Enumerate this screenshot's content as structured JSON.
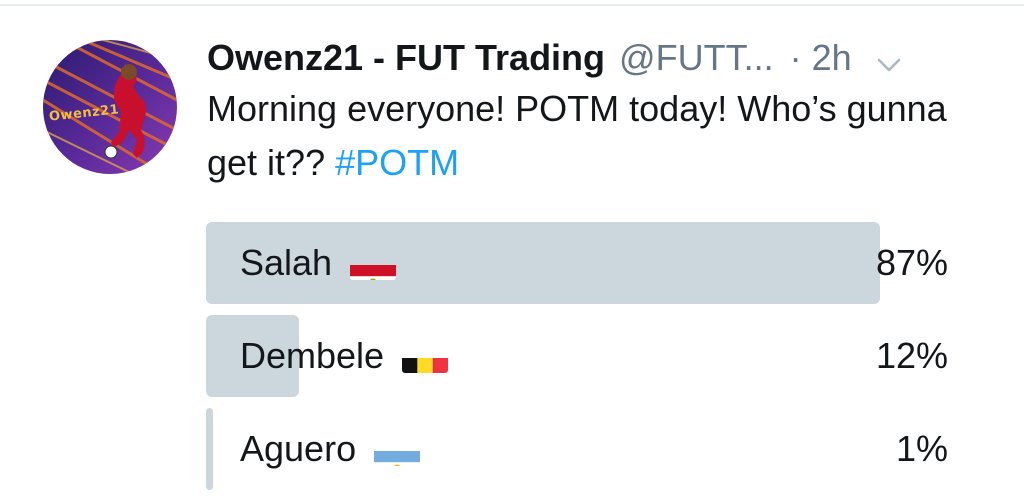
{
  "tweet": {
    "display_name": "Owenz21 - FUT Trading",
    "handle": "@FUTT...",
    "time": "· 2h",
    "text_main": "Morning everyone! POTM today! Who’s gunna get it?? ",
    "hashtag": "#POTM",
    "avatar_text": "Owenz21"
  },
  "poll": {
    "options": [
      {
        "label": "Salah",
        "flag_icon": "egypt-flag-icon",
        "percent_text": "87%",
        "percent": 87
      },
      {
        "label": "Dembele",
        "flag_icon": "belgium-flag-icon",
        "percent_text": "12%",
        "percent": 12
      },
      {
        "label": "Aguero",
        "flag_icon": "argentina-flag-icon",
        "percent_text": "1%",
        "percent": 1
      }
    ]
  },
  "colors": {
    "hashtag": "#1da1f2",
    "poll_bar": "#ccd6dd",
    "secondary_text": "#657786"
  }
}
